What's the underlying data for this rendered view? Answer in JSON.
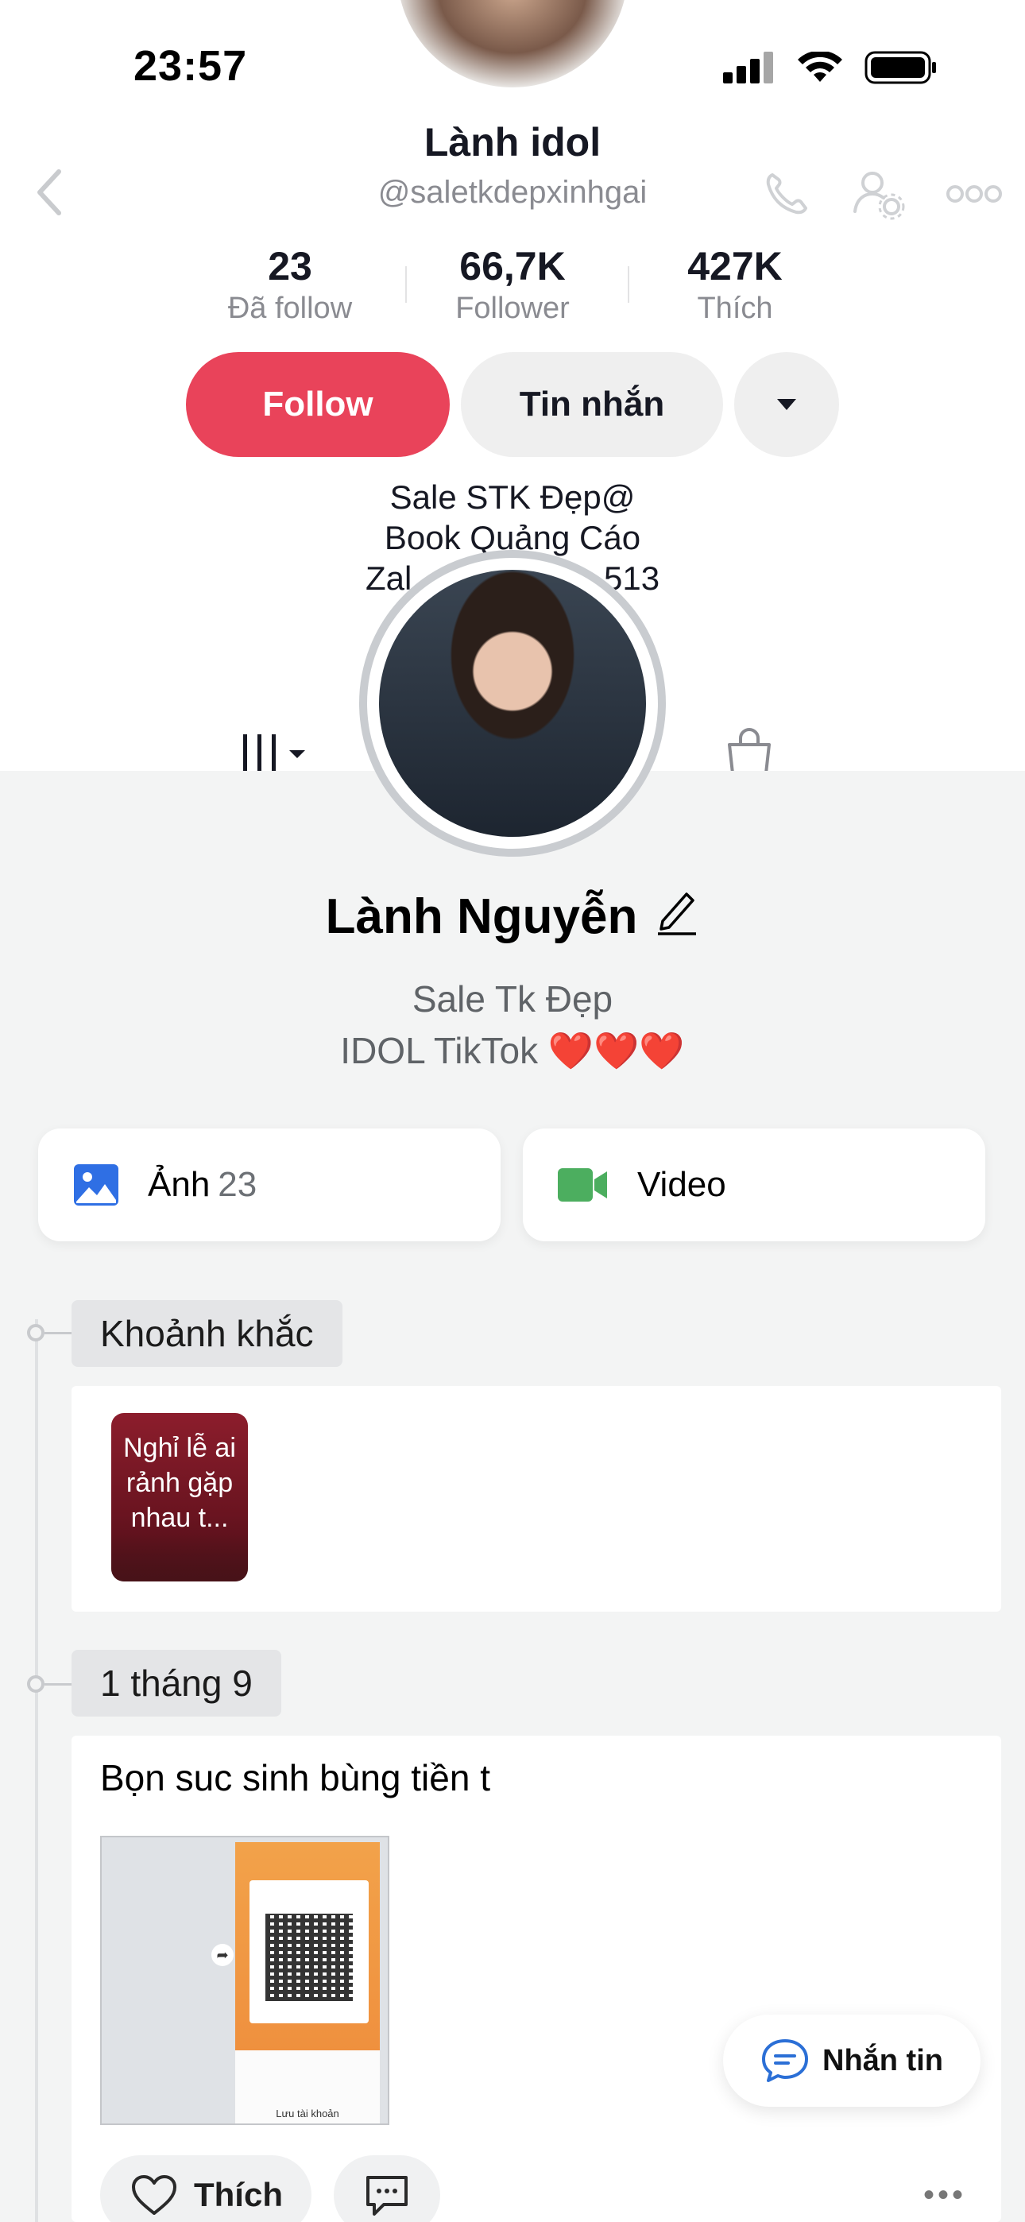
{
  "status_bar": {
    "time": "23:57"
  },
  "tiktok_profile": {
    "display_name": "Lành idol",
    "username": "@saletkdepxinhgai",
    "stats": [
      {
        "value": "23",
        "label": "Đã follow"
      },
      {
        "value": "66,7K",
        "label": "Follower"
      },
      {
        "value": "427K",
        "label": "Thích"
      }
    ],
    "follow_label": "Follow",
    "message_label": "Tin nhắn",
    "bio_lines": [
      "Sale STK Đẹp@",
      "Book Quảng Cáo",
      "Zal",
      "513"
    ]
  },
  "zalo_profile": {
    "name": "Lành Nguyễn",
    "bio_line_1": "Sale Tk Đẹp",
    "bio_line_2": "IDOL TikTok ❤️❤️❤️",
    "photos_label": "Ảnh",
    "photos_count": "23",
    "video_label": "Video",
    "moments_label": "Khoảnh khắc",
    "moment_text": "Nghỉ lễ ai rảnh gặp nhau t...",
    "date_label": "1 tháng 9",
    "post_text": "Bọn suc sinh bùng tiền t",
    "qr_caption": "Lưu tài khoản",
    "chat_button_label": "Nhắn tin",
    "like_label": "Thích"
  },
  "colors": {
    "follow_red": "#e9435a",
    "zalo_bg": "#f3f4f4",
    "photo_icon_blue": "#2f6fe4",
    "video_icon_green": "#4cae5f",
    "chat_icon_blue": "#2b6fd6"
  }
}
